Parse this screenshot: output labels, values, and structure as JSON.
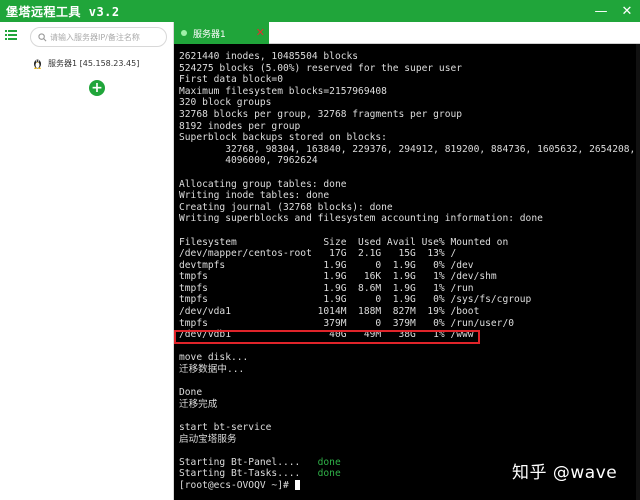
{
  "app": {
    "title": "堡塔远程工具 v3.2"
  },
  "window_controls": {
    "minimize": "—",
    "close": "✕"
  },
  "sidebar": {
    "search_placeholder": "请输入服务器IP/备注名称",
    "servers": [
      {
        "label": "服务器1 [45.158.23.45]"
      }
    ],
    "add_label": "+"
  },
  "tabs": [
    {
      "label": "服务器1",
      "close": "✕"
    }
  ],
  "terminal": {
    "lines": [
      "2621440 inodes, 10485504 blocks",
      "524275 blocks (5.00%) reserved for the super user",
      "First data block=0",
      "Maximum filesystem blocks=2157969408",
      "320 block groups",
      "32768 blocks per group, 32768 fragments per group",
      "8192 inodes per group",
      "Superblock backups stored on blocks:",
      "        32768, 98304, 163840, 229376, 294912, 819200, 884736, 1605632, 2654208,",
      "        4096000, 7962624",
      "",
      "Allocating group tables: done",
      "Writing inode tables: done",
      "Creating journal (32768 blocks): done",
      "Writing superblocks and filesystem accounting information: done",
      "",
      "Filesystem               Size  Used Avail Use% Mounted on",
      "/dev/mapper/centos-root   17G  2.1G   15G  13% /",
      "devtmpfs                 1.9G     0  1.9G   0% /dev",
      "tmpfs                    1.9G   16K  1.9G   1% /dev/shm",
      "tmpfs                    1.9G  8.6M  1.9G   1% /run",
      "tmpfs                    1.9G     0  1.9G   0% /sys/fs/cgroup",
      "/dev/vda1               1014M  188M  827M  19% /boot",
      "tmpfs                    379M     0  379M   0% /run/user/0",
      "/dev/vdb1                 40G   49M   38G   1% /www",
      "",
      "move disk...",
      "迁移数据中...",
      "",
      "Done",
      "迁移完成",
      "",
      "start bt-service",
      "启动宝塔服务",
      "",
      "Starting Bt-Panel....",
      "Starting Bt-Tasks....",
      "[root@ecs-OVOQV ~]# "
    ],
    "done_label": "done",
    "ok_color": "#2fb148",
    "highlight_color": "#e0242a"
  },
  "watermark": "知乎 @wave",
  "colors": {
    "brand_green": "#20a53a",
    "terminal_bg": "#000000"
  },
  "icons": {
    "menu": "list-icon",
    "search": "search-icon",
    "server": "linux-penguin-icon",
    "add": "plus-icon"
  }
}
